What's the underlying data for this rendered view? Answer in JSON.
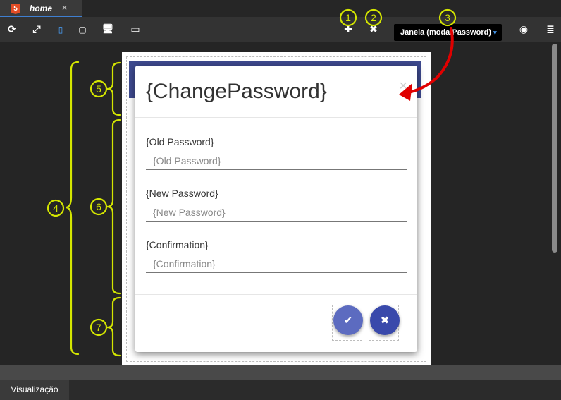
{
  "tab": {
    "badge": "5",
    "title": "home",
    "close": "×"
  },
  "toolbar": {
    "refresh": "⟳",
    "expand": "⤢",
    "device_mobile": "▯",
    "device_tablet": "▢",
    "device_desktop": "🖥",
    "device_monitor": "▭",
    "add": "✚",
    "remove": "✖",
    "window_select": {
      "value": "Janela (modalPassword)",
      "caret": "▾"
    },
    "visibility": "◉",
    "database": "≣"
  },
  "modal": {
    "title": "{ChangePassword}",
    "close": "×",
    "fields": [
      {
        "label": "{Old Password}",
        "placeholder": "{Old Password}"
      },
      {
        "label": "{New Password}",
        "placeholder": "{New Password}"
      },
      {
        "label": "{Confirmation}",
        "placeholder": "{Confirmation}"
      }
    ],
    "confirm": "✔",
    "cancel": "✖"
  },
  "annotations": {
    "n1": "1",
    "n2": "2",
    "n3": "3",
    "n4": "4",
    "n5": "5",
    "n6": "6",
    "n7": "7"
  },
  "bottom": {
    "tab_label": "Visualização"
  },
  "colors": {
    "header": "#3e4a8f",
    "confirm": "#5c6bc0",
    "cancel": "#3949ab",
    "annotation": "#d4e600",
    "arrow": "#e00000"
  }
}
